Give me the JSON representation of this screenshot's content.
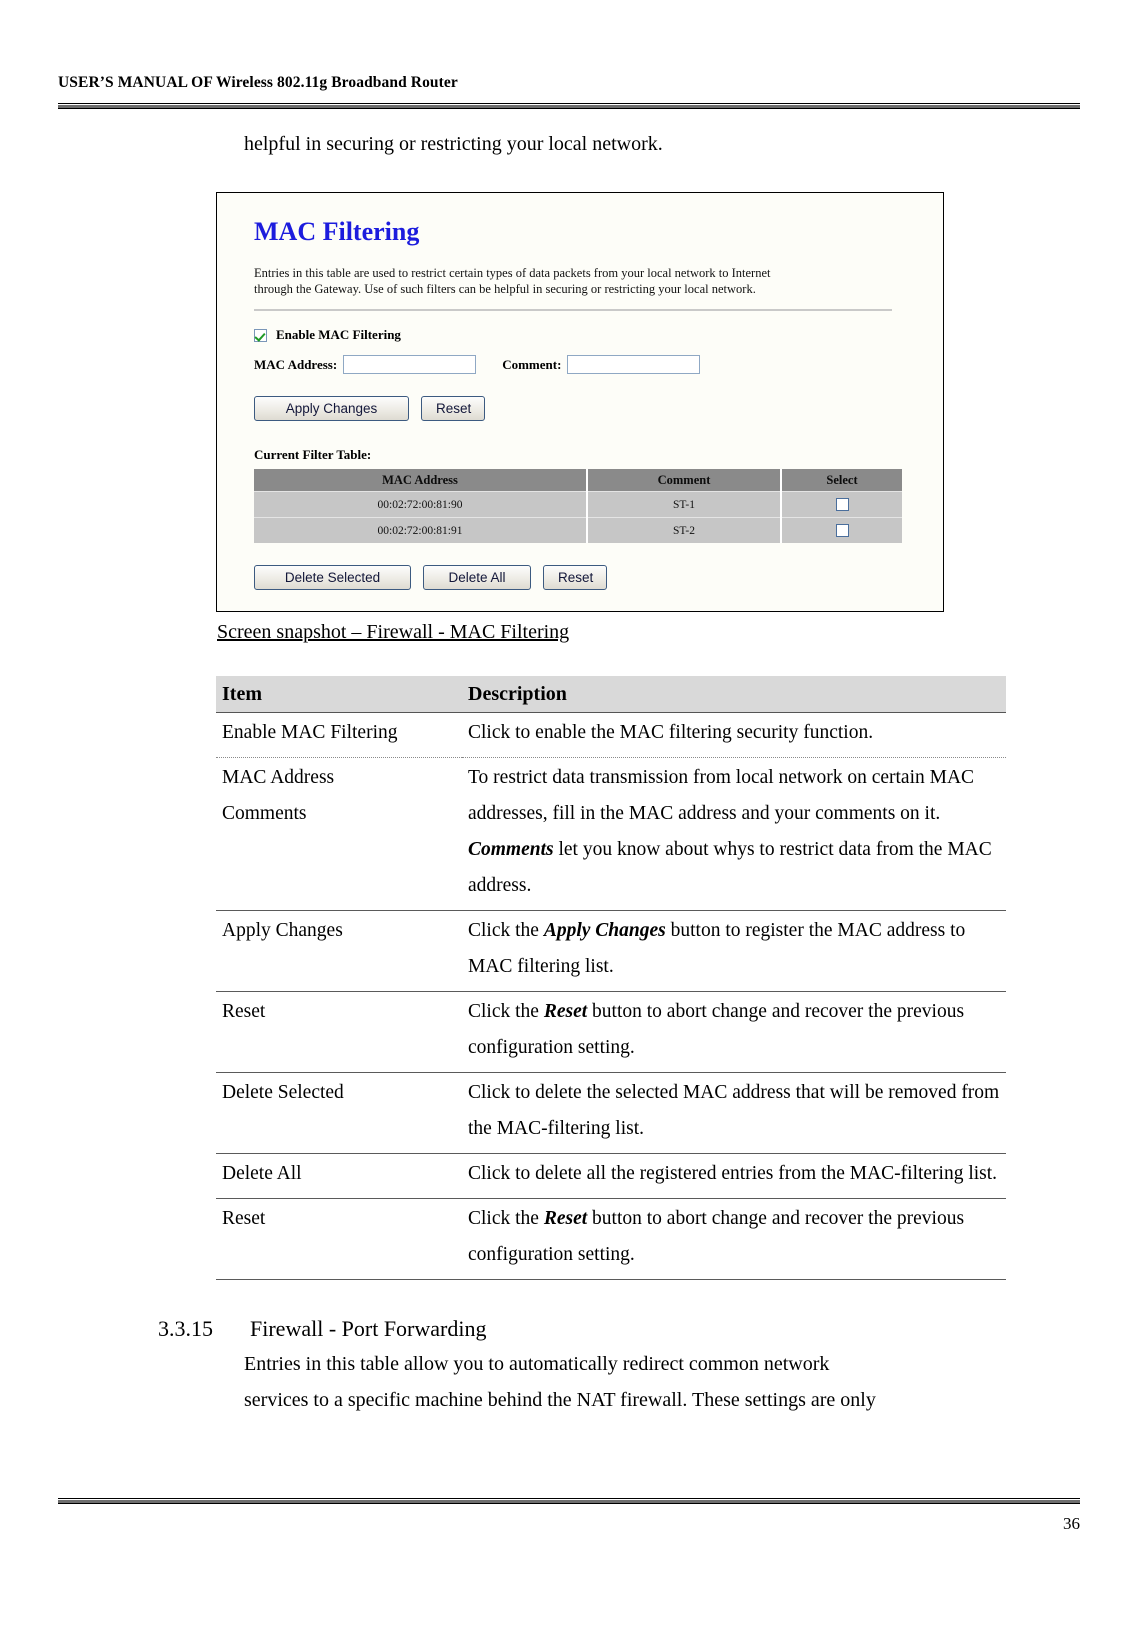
{
  "header": {
    "title": "USER’S MANUAL OF Wireless 802.11g Broadband Router"
  },
  "intro": {
    "line": "helpful in securing or restricting your local network."
  },
  "router_ui": {
    "title": "MAC Filtering",
    "description_line1": "Entries in this table are used to restrict certain types of data packets from your local network to Internet",
    "description_line2": "through the Gateway. Use of such filters can be helpful in securing or restricting your local network.",
    "enable_checkbox_label": "Enable MAC Filtering",
    "enable_checkbox_checked": true,
    "mac_address_label": "MAC Address:",
    "mac_address_value": "",
    "comment_label": "Comment:",
    "comment_value": "",
    "apply_changes_label": "Apply Changes",
    "reset_label": "Reset",
    "current_filter_table_label": "Current Filter Table:",
    "table_headers": [
      "MAC Address",
      "Comment",
      "Select"
    ],
    "table_rows": [
      {
        "mac": "00:02:72:00:81:90",
        "comment": "ST-1",
        "selected": false
      },
      {
        "mac": "00:02:72:00:81:91",
        "comment": "ST-2",
        "selected": false
      }
    ],
    "delete_selected_label": "Delete Selected",
    "delete_all_label": "Delete All",
    "reset_bottom_label": "Reset",
    "title_color": "#1c1cdd",
    "header_row_color": "#8a8a8a",
    "row_color": "#c6c6c6"
  },
  "figure_caption": "Screen snapshot – Firewall - MAC Filtering",
  "desc_table": {
    "headers": {
      "item": "Item",
      "description": "Description"
    },
    "rows": [
      {
        "item": "Enable MAC Filtering",
        "item2": "",
        "desc_parts": [
          {
            "t": "Click to enable the MAC filtering security function.",
            "b": false
          }
        ]
      },
      {
        "item": "MAC Address",
        "item2": "Comments",
        "desc_parts": [
          {
            "t": "To restrict data transmission from local network on certain MAC addresses, fill in the MAC address and your comments on it. ",
            "b": false
          },
          {
            "t": "Comments",
            "b": true
          },
          {
            "t": " let you know about whys to restrict data from the MAC address.",
            "b": false
          }
        ]
      },
      {
        "item": "Apply Changes",
        "item2": "",
        "desc_parts": [
          {
            "t": "Click the ",
            "b": false
          },
          {
            "t": "Apply Changes",
            "b": true
          },
          {
            "t": " button to register the MAC address to MAC filtering list.",
            "b": false
          }
        ]
      },
      {
        "item": "Reset",
        "item2": "",
        "desc_parts": [
          {
            "t": "Click the ",
            "b": false
          },
          {
            "t": "Reset",
            "b": true
          },
          {
            "t": " button to abort change and recover the previous configuration setting.",
            "b": false
          }
        ]
      },
      {
        "item": "Delete Selected",
        "item2": "",
        "desc_parts": [
          {
            "t": "Click to delete the selected MAC address that will be removed from the MAC-filtering list.",
            "b": false
          }
        ]
      },
      {
        "item": "Delete All",
        "item2": "",
        "desc_parts": [
          {
            "t": "Click to delete all the registered entries from the MAC-filtering list.",
            "b": false
          }
        ]
      },
      {
        "item": "Reset",
        "item2": "",
        "desc_parts": [
          {
            "t": "Click the ",
            "b": false
          },
          {
            "t": "Reset",
            "b": true
          },
          {
            "t": " button to abort change and recover the previous configuration setting.",
            "b": false
          }
        ]
      }
    ]
  },
  "section": {
    "number": "3.3.15",
    "title": "Firewall - Port Forwarding",
    "body_line1": "Entries in this table allow you to automatically redirect common network",
    "body_line2": "services to a specific machine behind the NAT firewall. These settings are only"
  },
  "footer": {
    "page_number": "36"
  }
}
